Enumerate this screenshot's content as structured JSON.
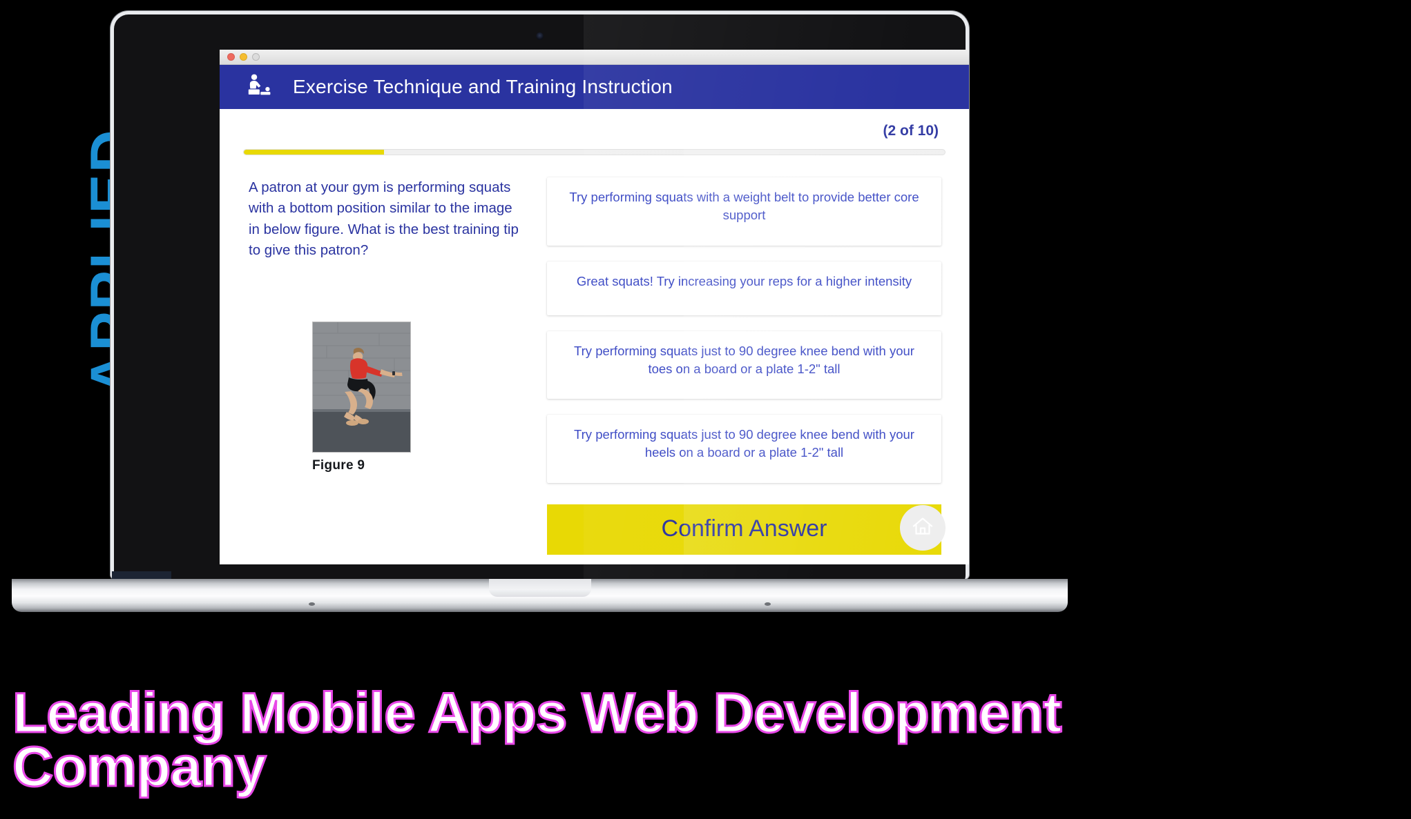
{
  "side_label": {
    "text": "APPLIED"
  },
  "window": {
    "traffic_lights": [
      "close-button",
      "minimize-button",
      "zoom-button"
    ]
  },
  "header": {
    "icon": "physiotherapy-icon",
    "title": "Exercise Technique and Training Instruction",
    "bg_color": "#2a33a0"
  },
  "quiz": {
    "counter": "(2 of 10)",
    "progress_percent": 20,
    "progress_color": "#e8d905",
    "question": "A patron at your gym is performing squats with a bottom position similar to the image in below figure. What is the best training tip to give this patron?",
    "figure": {
      "caption": "Figure 9",
      "alt": "man performing a deep bodyweight squat with arms extended forward"
    },
    "options": [
      "Try performing squats with a weight belt to provide better core support",
      "Great squats! Try increasing your reps for a higher intensity",
      "Try performing squats just to 90 degree knee bend with your toes on a board or a plate 1-2\" tall",
      "Try performing squats just to 90 degree knee bend with your heels on a board or a plate 1-2\" tall"
    ],
    "confirm_label": "Confirm Answer",
    "confirm_bg": "#e8d905",
    "confirm_text_color": "#2a33a0",
    "home_icon": "home-icon"
  },
  "overlay": {
    "line1": "Leading Mobile Apps Web Development",
    "line2": "Company",
    "outline_color": "#e848e8"
  }
}
